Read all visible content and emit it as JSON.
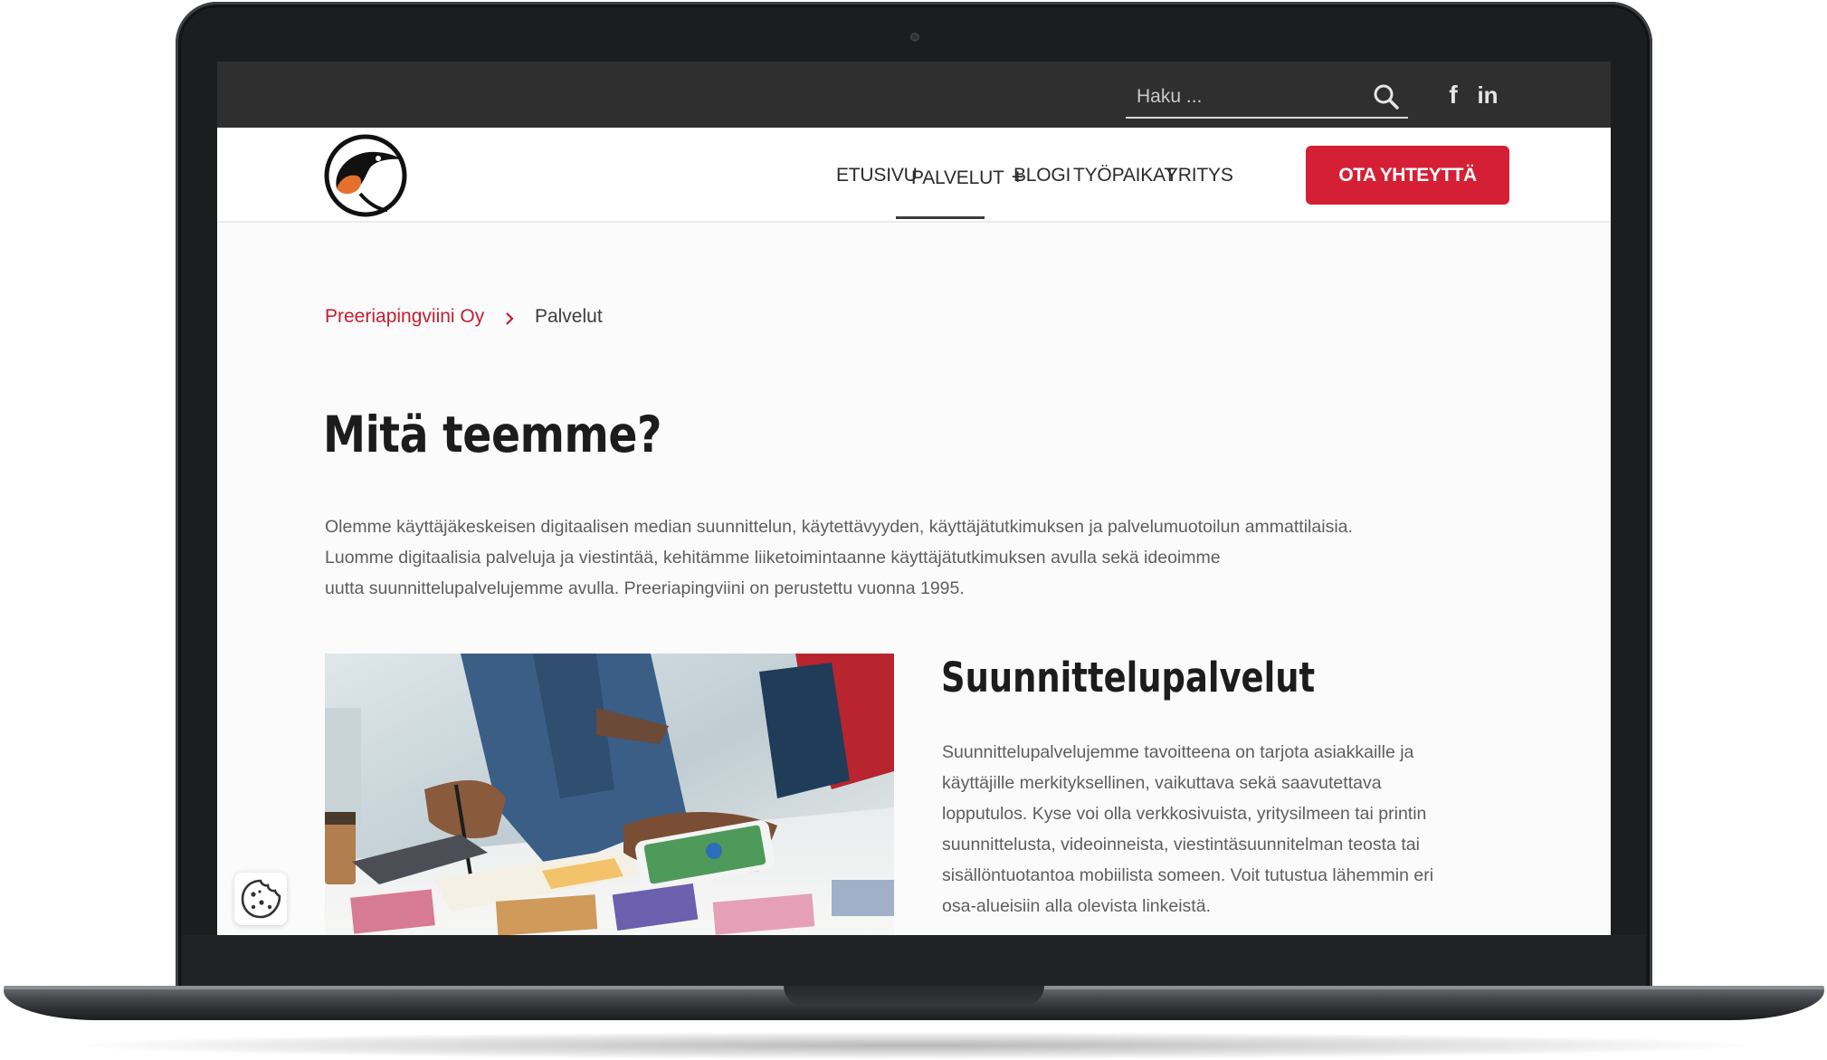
{
  "header": {
    "search": {
      "placeholder": "Haku ..."
    },
    "social": [
      {
        "label": "f",
        "icon": "facebook-icon"
      },
      {
        "label": "in",
        "icon": "linkedin-icon"
      }
    ]
  },
  "nav": {
    "items": [
      {
        "label": "ETUSIVU"
      },
      {
        "label": "PALVELUT"
      },
      {
        "label": "BLOGI"
      },
      {
        "label": "TYÖPAIKAT"
      },
      {
        "label": "YRITYS"
      }
    ],
    "active": "PALVELUT",
    "submenu_indicator": "+",
    "cta_label": "OTA YHTEYTTÄ"
  },
  "breadcrumb": {
    "home": "Preeriapingviini Oy",
    "current": "Palvelut"
  },
  "main": {
    "title": "Mitä teemme?",
    "intro_lines": [
      "Olemme käyttäjäkeskeisen digitaalisen median suunnittelun, käytettävyyden, käyttäjätutkimuksen ja palvelumuotoilun ammattilaisia.",
      "Luomme digitaalisia palveluja ja viestintää, kehitämme liiketoimintaanne käyttäjätutkimuksen avulla sekä ideoimme",
      "uutta suunnittelupalvelujemme avulla. Preeriapingviini on perustettu vuonna 1995."
    ],
    "section": {
      "title": "Suunnittelupalvelut",
      "body_lines": [
        "Suunnittelupalvelujemme tavoitteena on tarjota asiakkaille ja",
        "käyttäjille merkityksellinen, vaikuttava sekä saavutettava",
        "lopputulos. Kyse voi olla verkkosivuista, yritysilmeen tai printin",
        "suunnittelusta, videoinneista, viestintäsuunnitelman teosta tai",
        "sisällöntuotantoa mobiilista someen. Voit tutustua lähemmin eri",
        "osa-alueisiin alla olevista linkeistä."
      ]
    }
  },
  "colors": {
    "accent": "#d51f35",
    "topbar": "#2f2f2f",
    "text": "#5e5e5e"
  }
}
